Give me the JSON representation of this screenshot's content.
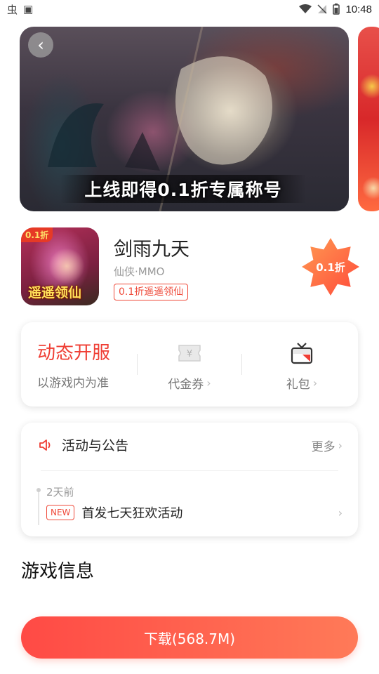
{
  "status_bar": {
    "left_glyphs": [
      "虫",
      "▣"
    ],
    "time": "10:48"
  },
  "banner": {
    "caption": "上线即得0.1折专属称号",
    "back_icon": "chevron-left-icon"
  },
  "game": {
    "title": "剑雨九天",
    "genre": "仙侠·MMO",
    "tag": "0.1折遥遥领仙",
    "icon_corner": "0.1折",
    "icon_stamp": "遥遥领仙",
    "discount": "0.1折"
  },
  "service": {
    "open_server": "动态开服",
    "open_server_note": "以游戏内为准",
    "voucher": "代金券",
    "gift": "礼包"
  },
  "notices": {
    "title": "活动与公告",
    "more": "更多",
    "items": [
      {
        "time": "2天前",
        "badge": "NEW",
        "text": "首发七天狂欢活动"
      }
    ]
  },
  "info": {
    "title": "游戏信息"
  },
  "download": {
    "label": "下载(568.7M)"
  },
  "colors": {
    "accent": "#ef3e34",
    "download_start": "#ff4a45",
    "download_end": "#ff7a58"
  }
}
